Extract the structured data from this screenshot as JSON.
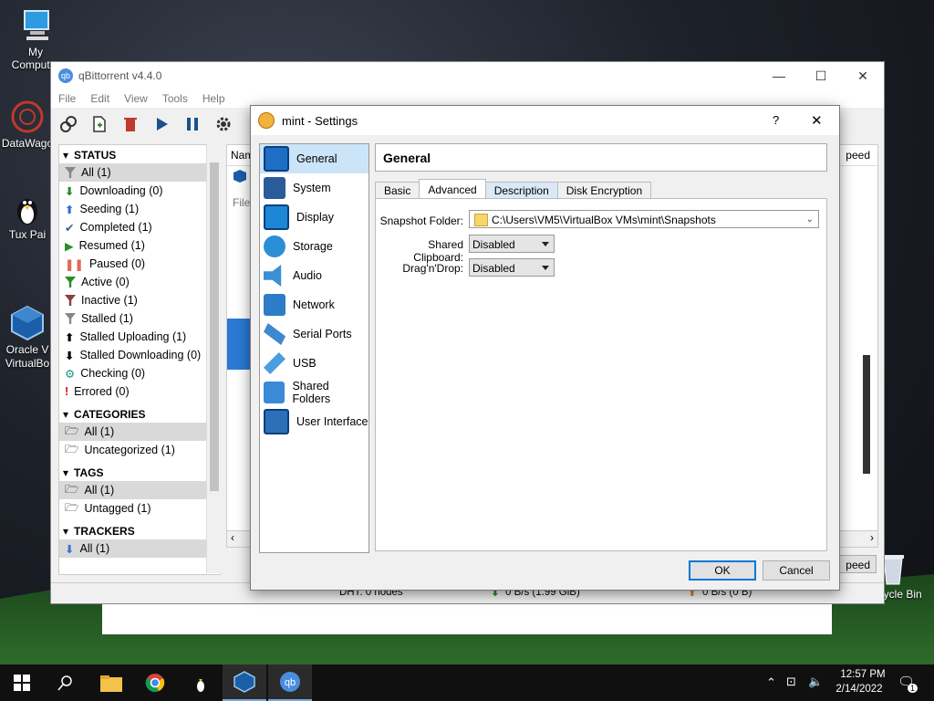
{
  "desktop": {
    "icons": [
      {
        "label": "My Computer"
      },
      {
        "label": "DataWago"
      },
      {
        "label": "Tux Pai"
      },
      {
        "label": "Oracle V\nVirtualBo"
      },
      {
        "label": "Recycle Bin"
      }
    ]
  },
  "qbittorrent": {
    "title": "qBittorrent v4.4.0",
    "menu": [
      "File",
      "Edit",
      "View",
      "Tools",
      "Help"
    ],
    "sidebar": {
      "status_header": "STATUS",
      "status_items": [
        {
          "label": "All (1)",
          "color": "#888888"
        },
        {
          "label": "Downloading (0)",
          "color": "#2e8b2e"
        },
        {
          "label": "Seeding (1)",
          "color": "#3a6fd8"
        },
        {
          "label": "Completed (1)",
          "color": "#3a5f8a"
        },
        {
          "label": "Resumed (1)",
          "color": "#2e8b2e"
        },
        {
          "label": "Paused (0)",
          "color": "#e06a5a"
        },
        {
          "label": "Active (0)",
          "color": "#2e8b2e"
        },
        {
          "label": "Inactive (1)",
          "color": "#8a4040"
        },
        {
          "label": "Stalled (1)",
          "color": "#888888"
        },
        {
          "label": "Stalled Uploading (1)",
          "color": "#111111"
        },
        {
          "label": "Stalled Downloading (0)",
          "color": "#111111"
        },
        {
          "label": "Checking (0)",
          "color": "#1a9a8a"
        },
        {
          "label": "Errored (0)",
          "color": "#d01010"
        }
      ],
      "categories_header": "CATEGORIES",
      "categories_items": [
        "All (1)",
        "Uncategorized (1)"
      ],
      "tags_header": "TAGS",
      "tags_items": [
        "All (1)",
        "Untagged (1)"
      ],
      "trackers_header": "TRACKERS",
      "trackers_items": [
        "All (1)"
      ]
    },
    "list_header": "Nam",
    "list_header_right": "peed",
    "list_sub": "File",
    "bottom_right_button": "peed",
    "status": {
      "dht": "DHT: 0 nodes",
      "download": "0 B/s (1.99 GiB)",
      "upload": "0 B/s (0 B)"
    }
  },
  "settings_dialog": {
    "title": "mint - Settings",
    "help": "?",
    "close": "✕",
    "nav": [
      {
        "label": "General",
        "color": "#1c6fc4"
      },
      {
        "label": "System",
        "color": "#2a5b9a"
      },
      {
        "label": "Display",
        "color": "#1d86d6"
      },
      {
        "label": "Storage",
        "color": "#2b8fd6"
      },
      {
        "label": "Audio",
        "color": "#3d8fd4"
      },
      {
        "label": "Network",
        "color": "#2d7cc7"
      },
      {
        "label": "Serial Ports",
        "color": "#3d88cf"
      },
      {
        "label": "USB",
        "color": "#4a9de0"
      },
      {
        "label": "Shared Folders",
        "color": "#3a8ad6"
      },
      {
        "label": "User Interface",
        "color": "#2b6fb8"
      }
    ],
    "section_title": "General",
    "tabs": [
      "Basic",
      "Advanced",
      "Description",
      "Disk Encryption"
    ],
    "fields": {
      "snapshot_label": "Snapshot Folder:",
      "snapshot_value": "C:\\Users\\VM5\\VirtualBox VMs\\mint\\Snapshots",
      "clipboard_label": "Shared Clipboard:",
      "clipboard_value": "Disabled",
      "dragdrop_label": "Drag'n'Drop:",
      "dragdrop_value": "Disabled"
    },
    "ok": "OK",
    "cancel": "Cancel"
  },
  "taskbar": {
    "time": "12:57 PM",
    "date": "2/14/2022",
    "notification_count": "1"
  }
}
